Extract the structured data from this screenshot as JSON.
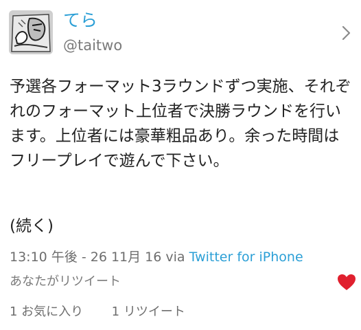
{
  "user": {
    "display_name": "てら",
    "handle": "@taitwo",
    "avatar": "manga-portrait-avatar"
  },
  "tweet": {
    "text": "予選各フォーマット3ラウンドずつ実施、それぞれのフォーマット上位者で決勝ラウンドを行います。上位者には豪華粗品あり。余った時間はフリープレイで遊んで下さい。",
    "continuation": "(続く)"
  },
  "meta": {
    "timestamp": "13:10 午後 - 26 11月 16",
    "via": "via",
    "client": "Twitter for iPhone"
  },
  "retweet_status": "あなたがリツイート",
  "stats": {
    "likes": "1 お気に入り",
    "retweets": "1 リツイート"
  },
  "icons": {
    "chevron": "chevron-right-icon",
    "like": "heart-icon"
  },
  "colors": {
    "link": "#2b9fd6",
    "like_active": "#e0202e",
    "secondary_text": "#6d6d6d"
  }
}
